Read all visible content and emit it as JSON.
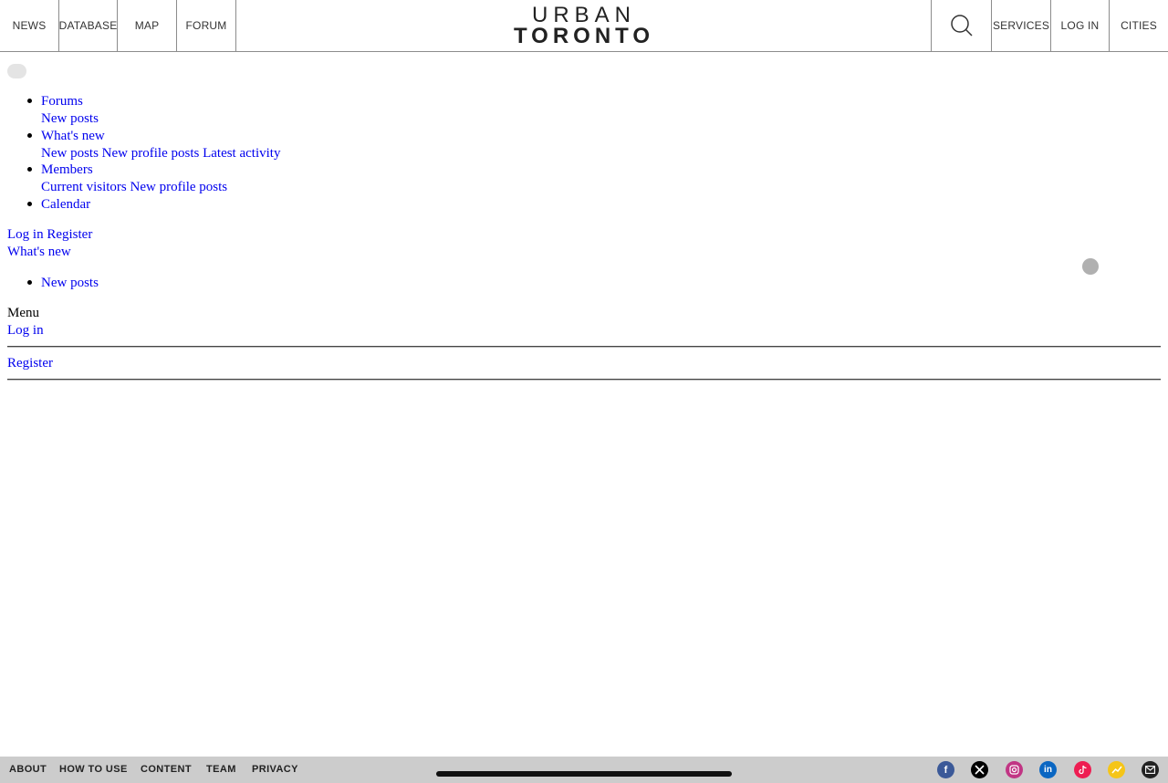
{
  "header": {
    "nav_left": [
      "NEWS",
      "DATABASE",
      "MAP",
      "FORUM"
    ],
    "logo_line1": "URBAN",
    "logo_line2": "TORONTO",
    "nav_right": [
      "SERVICES",
      "LOG IN",
      "CITIES"
    ]
  },
  "forum_nav": {
    "forums": "Forums",
    "forums_sub": [
      "New posts"
    ],
    "whats_new": "What's new",
    "whats_new_sub": [
      "New posts",
      "New profile posts",
      "Latest activity"
    ],
    "members": "Members",
    "members_sub": [
      "Current visitors",
      "New profile posts"
    ],
    "calendar": "Calendar"
  },
  "account": {
    "login": "Log in",
    "register": "Register"
  },
  "section_title": "What's new",
  "section_links": [
    "New posts"
  ],
  "menu": {
    "label": "Menu",
    "login": "Log in",
    "register": "Register"
  },
  "footer": {
    "links": [
      "ABOUT",
      "HOW TO USE",
      "CONTENT",
      "TEAM",
      "PRIVACY"
    ],
    "social_icons": [
      "facebook-icon",
      "x-icon",
      "instagram-icon",
      "linkedin-icon",
      "tiktok-icon",
      "trending-icon",
      "email-icon"
    ]
  },
  "colors": {
    "link": "#0000ee",
    "footer_bg": "#cccccc",
    "facebook": "#3b5998",
    "x": "#000000",
    "instagram": "#c13584",
    "linkedin": "#0a66c2",
    "tiktok": "#ee1d52",
    "trending": "#f5c518",
    "email": "#222222"
  }
}
